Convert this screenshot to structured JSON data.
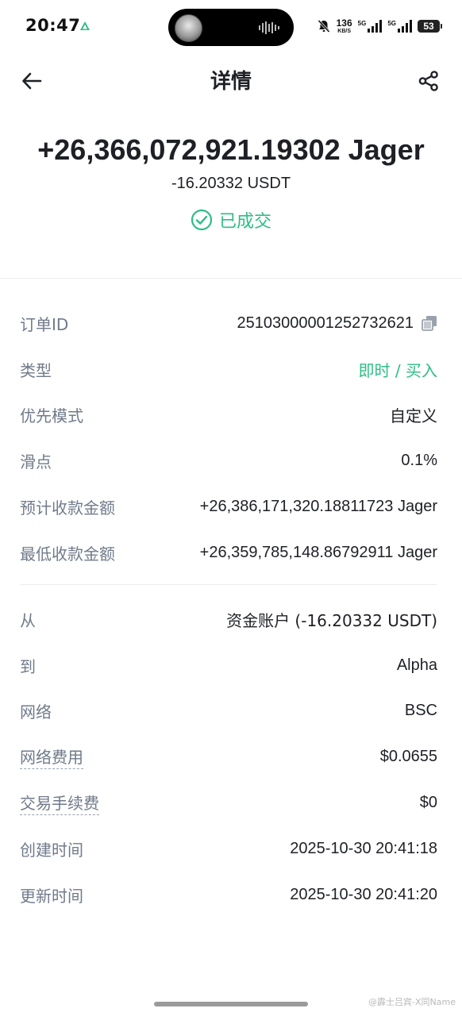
{
  "status_bar": {
    "time": "20:47",
    "net_speed": "136",
    "net_unit": "KB/S",
    "signal_1_label": "5G",
    "signal_2_label": "5G",
    "battery": "53"
  },
  "header": {
    "title": "详情"
  },
  "summary": {
    "amount": "+26,366,072,921.19302 Jager",
    "paid": "-16.20332 USDT",
    "status": "已成交"
  },
  "details": [
    {
      "label": "订单ID",
      "value": "2510300000125273262​1"
    },
    {
      "label": "类型",
      "value": "即时 / 买入"
    },
    {
      "label": "优先模式",
      "value": "自定义"
    },
    {
      "label": "滑点",
      "value": "0.1%"
    },
    {
      "label": "预计收款金额",
      "value": "+26,386,171,320.18811723 Jager"
    },
    {
      "label": "最低收款金额",
      "value": "+26,359,785,148.86792911 Jager"
    }
  ],
  "transfer": [
    {
      "label": "从",
      "value": "资金账户 (-16.20332 USDT)"
    },
    {
      "label": "到",
      "value": "Alpha"
    },
    {
      "label": "网络",
      "value": "BSC"
    },
    {
      "label": "网络费用",
      "value": "$0.0655"
    },
    {
      "label": "交易手续费",
      "value": "$0"
    },
    {
      "label": "创建时间",
      "value": "2025-10-30 20:41:18"
    },
    {
      "label": "更新时间",
      "value": "2025-10-30 20:41:20"
    }
  ],
  "watermark": "@霹士吕宾-X同Name",
  "colors": {
    "accent_green": "#2ebd85",
    "label_gray": "#707a8a",
    "text_dark": "#1e2026"
  }
}
